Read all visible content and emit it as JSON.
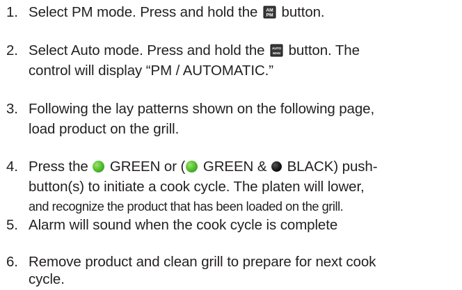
{
  "steps": [
    {
      "number": "1.",
      "line1_before": "Select PM mode.  Press and hold the ",
      "icon": "am-pm-button-icon",
      "icon_text_top": "AM",
      "icon_text_bottom": "PM",
      "line1_after": " button."
    },
    {
      "number": "2.",
      "line1_before": "Select Auto mode.  Press and hold the ",
      "icon": "auto-man-button-icon",
      "icon_text_top": "AUTO",
      "icon_text_bottom": "MAN",
      "line1_after": " button. The",
      "line2": "control will display “PM / AUTOMATIC.”"
    },
    {
      "number": "3.",
      "line1": "Following the lay patterns shown on the following page,",
      "line2": "load product on the grill."
    },
    {
      "number": "4.",
      "line1_a": "Press the ",
      "green_label_1": " GREEN or (",
      "green_label_2": " GREEN & ",
      "black_label": " BLACK) push-",
      "line2": "button(s) to initiate a cook cycle. The platen will lower,",
      "line3": "and recognize the product that has been loaded on the grill."
    },
    {
      "number": "5.",
      "line1": "Alarm will sound when the cook cycle is complete"
    },
    {
      "number": "6.",
      "line1": "Remove product and clean grill to prepare for next cook",
      "line2": "cycle."
    }
  ],
  "colors": {
    "text": "#231f20",
    "green_button": "#4cb82a",
    "black_button": "#111111",
    "icon_bg": "#1f1f1f"
  }
}
